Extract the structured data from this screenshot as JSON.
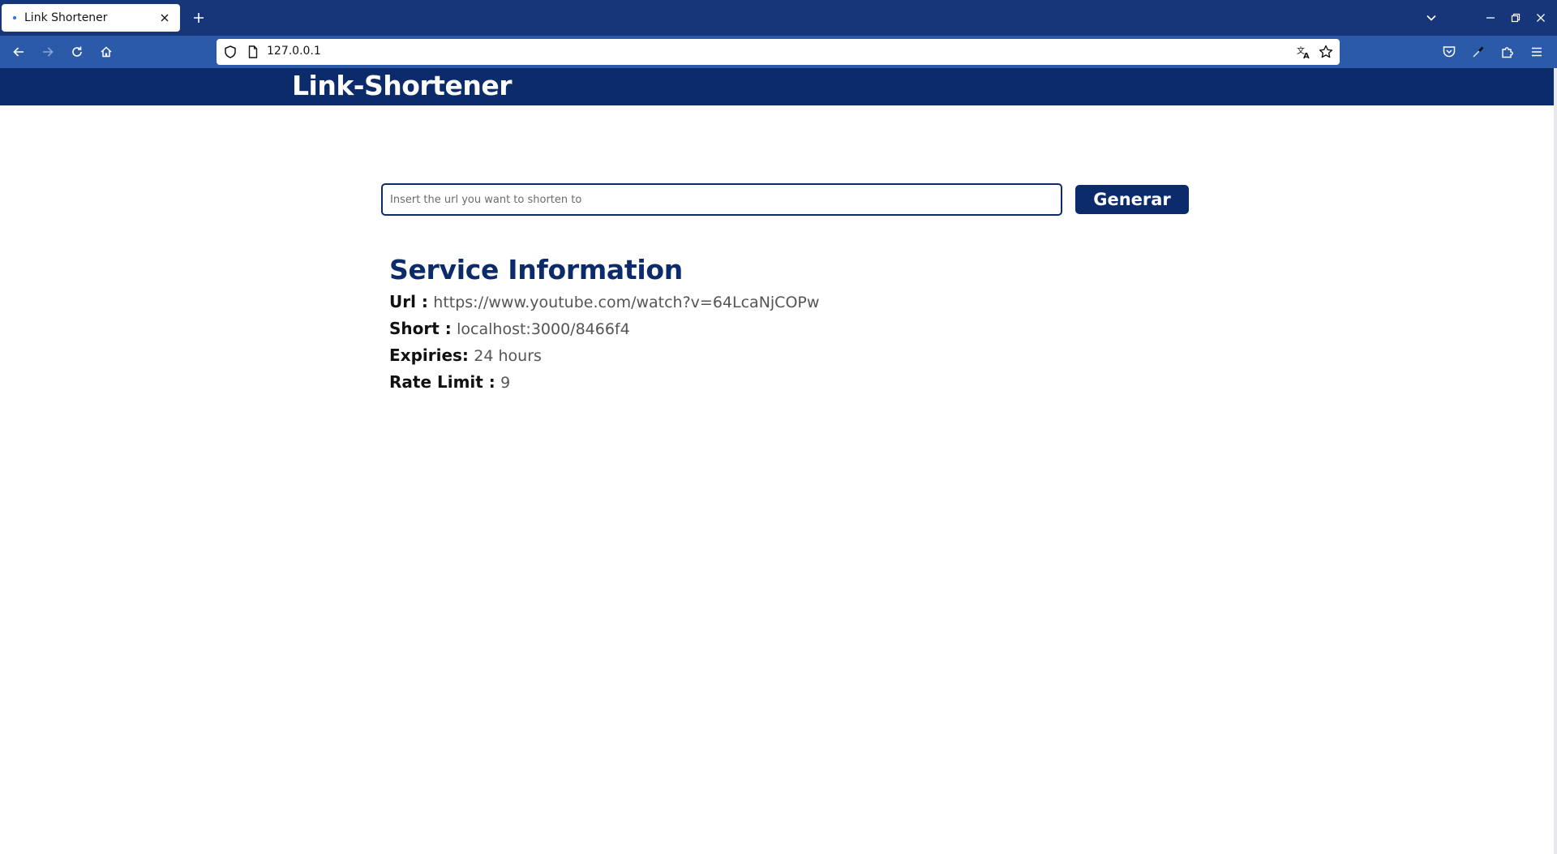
{
  "browser": {
    "tab": {
      "title": "Link Shortener"
    },
    "address_bar": {
      "url": "127.0.0.1"
    }
  },
  "page": {
    "header": {
      "title": "Link-Shortener"
    },
    "form": {
      "input_placeholder": "Insert the url you want to shorten to",
      "input_value": "",
      "button_label": "Generar"
    },
    "service_info": {
      "heading": "Service Information",
      "rows": [
        {
          "label": "Url :",
          "value": "https://www.youtube.com/watch?v=64LcaNjCOPw"
        },
        {
          "label": "Short :",
          "value": "localhost:3000/8466f4"
        },
        {
          "label": "Expiries:",
          "value": "24 hours"
        },
        {
          "label": "Rate Limit :",
          "value": "9"
        }
      ]
    }
  },
  "colors": {
    "brand_navy": "#0c2b6b",
    "browser_tabbar": "#17367a",
    "browser_toolbar": "#2b5aa8"
  }
}
